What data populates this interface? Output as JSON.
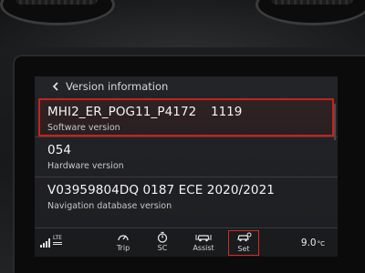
{
  "header": {
    "title": "Version information"
  },
  "items": [
    {
      "value": "MHI2_ER_POG11_P4172",
      "value_extra": "1119",
      "label": "Software version"
    },
    {
      "value": "054",
      "label": "Hardware version"
    },
    {
      "value": "V03959804DQ 0187 ECE 2020/2021",
      "label": "Navigation database version"
    }
  ],
  "status": {
    "network": "LTE",
    "signal_icon": "signal-bars-icon"
  },
  "toolbar": {
    "trip_label": "Trip",
    "sc_label": "SC",
    "assist_label": "Assist",
    "set_label": "Set"
  },
  "temperature": {
    "value": "9.0",
    "unit": "°C"
  },
  "colors": {
    "accent": "#c7211f",
    "background": "#1d1e21",
    "text": "#e9e9ea"
  }
}
